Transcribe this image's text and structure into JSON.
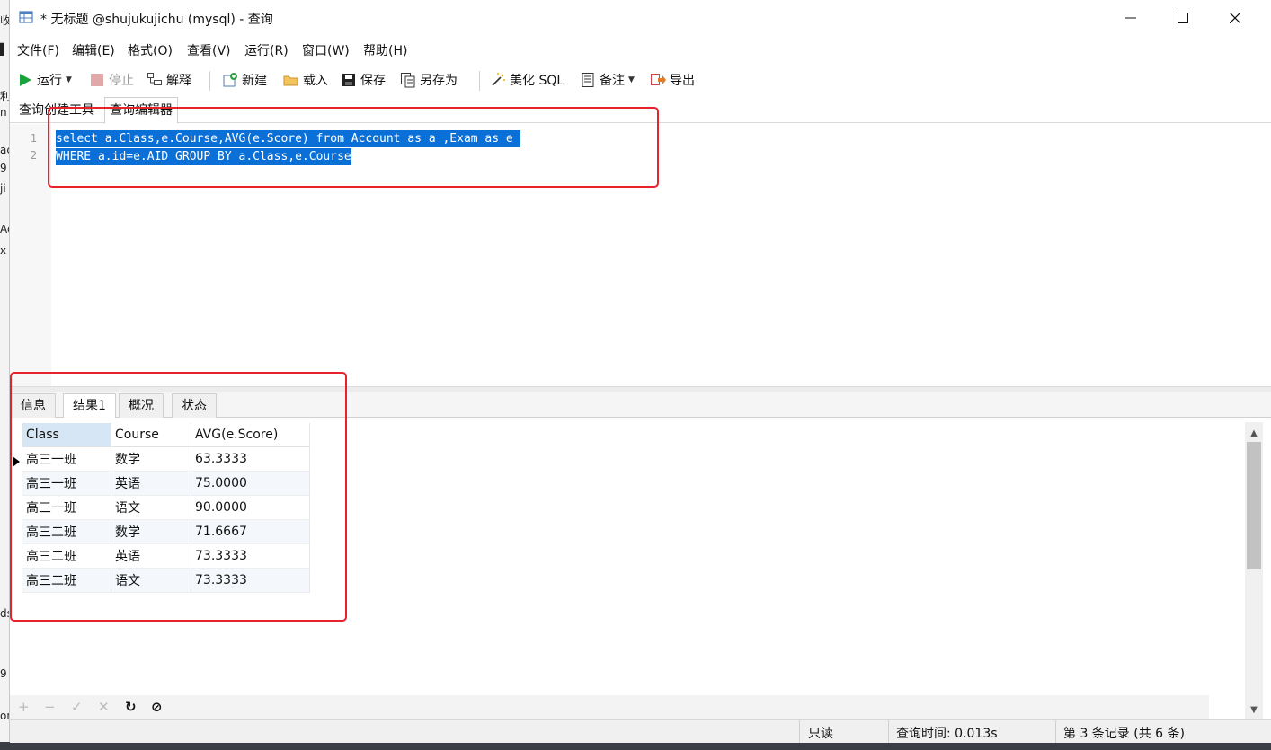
{
  "window": {
    "title": "* 无标题 @shujukujichu (mysql) - 查询"
  },
  "menu": [
    "文件(F)",
    "编辑(E)",
    "格式(O)",
    "查看(V)",
    "运行(R)",
    "窗口(W)",
    "帮助(H)"
  ],
  "toolbar": {
    "run": "运行",
    "stop": "停止",
    "explain": "解释",
    "new": "新建",
    "load": "载入",
    "save": "保存",
    "save_as": "另存为",
    "beautify": "美化 SQL",
    "comment": "备注",
    "export": "导出"
  },
  "editor_tabs": [
    "查询创建工具",
    "查询编辑器"
  ],
  "editor": {
    "lines": [
      {
        "num": "1",
        "text": "select a.Class,e.Course,AVG(e.Score) from Account as a ,Exam as e "
      },
      {
        "num": "2",
        "text": "WHERE a.id=e.AID GROUP BY a.Class,e.Course"
      }
    ]
  },
  "result_tabs": [
    "信息",
    "结果1",
    "概况",
    "状态"
  ],
  "grid": {
    "columns": [
      "Class",
      "Course",
      "AVG(e.Score)"
    ],
    "rows": [
      [
        "高三一班",
        "数学",
        "63.3333"
      ],
      [
        "高三一班",
        "英语",
        "75.0000"
      ],
      [
        "高三一班",
        "语文",
        "90.0000"
      ],
      [
        "高三二班",
        "数学",
        "71.6667"
      ],
      [
        "高三二班",
        "英语",
        "73.3333"
      ],
      [
        "高三二班",
        "语文",
        "73.3333"
      ]
    ]
  },
  "status": {
    "mode": "只读",
    "query_time": "查询时间: 0.013s",
    "record": "第 3 条记录 (共 6 条)"
  },
  "colors": {
    "selection": "#0a6fd6",
    "highlight_box": "#e8222c"
  }
}
